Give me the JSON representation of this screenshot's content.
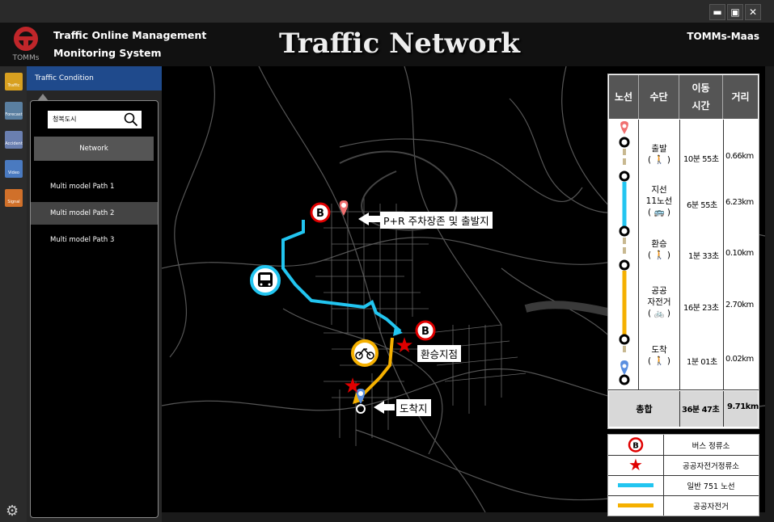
{
  "window": {
    "buttons": {
      "minimize": "▬",
      "maximize": "▣",
      "close": "✕"
    }
  },
  "header": {
    "logo_text": "TOMMs",
    "subtitle_line1": "Traffic Online Management",
    "subtitle_line2": "Monitoring System",
    "title": "Traffic Network",
    "brand": "TOMMs-Maas"
  },
  "rail": {
    "items": [
      {
        "label": "Traffic",
        "icon": "traffic-icon",
        "color": "#d8a020"
      },
      {
        "label": "Forecast",
        "icon": "forecast-icon",
        "color": "#5a7fa0"
      },
      {
        "label": "Accident",
        "icon": "accident-icon",
        "color": "#6a7fb0"
      },
      {
        "label": "Video",
        "icon": "video-icon",
        "color": "#4a7ac0"
      },
      {
        "label": "Signal",
        "icon": "signal-icon",
        "color": "#d0702a"
      }
    ]
  },
  "sidebar": {
    "tab_label": "Traffic Condition",
    "search_value": "청복도시",
    "network_button": "Network",
    "paths": [
      {
        "label": "Multi model Path 1",
        "selected": false
      },
      {
        "label": "Multi model Path 2",
        "selected": true
      },
      {
        "label": "Multi model Path 3",
        "selected": false
      }
    ]
  },
  "map": {
    "labels": {
      "origin": "P+R 주차장존 및 출발지",
      "transfer": "환승지점",
      "destination": "도착지"
    },
    "colors": {
      "bus_route": "#22c5f0",
      "bike_route": "#f5b000",
      "bus_stop": "#e00000",
      "bike_station": "#e00000"
    }
  },
  "table": {
    "headers": {
      "route": "노선",
      "mode": "수단",
      "time": "이동\n시간",
      "distance": "거리"
    },
    "rows": [
      {
        "mode": "출발\n( 🚶 )",
        "time": "10분 55초",
        "distance": "0.66km"
      },
      {
        "mode": "지선\n11노선\n( 🚌 )",
        "time": "6분 55초",
        "distance": "6.23km"
      },
      {
        "mode": "환승\n( 🚶 )",
        "time": "1분 33초",
        "distance": "0.10km"
      },
      {
        "mode": "공공\n자전거\n( 🚲 )",
        "time": "16분 23초",
        "distance": "2.70km"
      },
      {
        "mode": "도착\n( 🚶 )",
        "time": "1분 01초",
        "distance": "0.02km"
      }
    ],
    "total": {
      "label": "총합",
      "time": "36분 47초",
      "distance": "9.71km"
    }
  },
  "legend": {
    "items": [
      {
        "symbol": "B",
        "label": "버스 정류소"
      },
      {
        "symbol": "★",
        "label": "공공자전거정류소"
      },
      {
        "symbol": "line-blue",
        "label": "일반 751 노선"
      },
      {
        "symbol": "line-yellow",
        "label": "공공자전거"
      }
    ]
  }
}
